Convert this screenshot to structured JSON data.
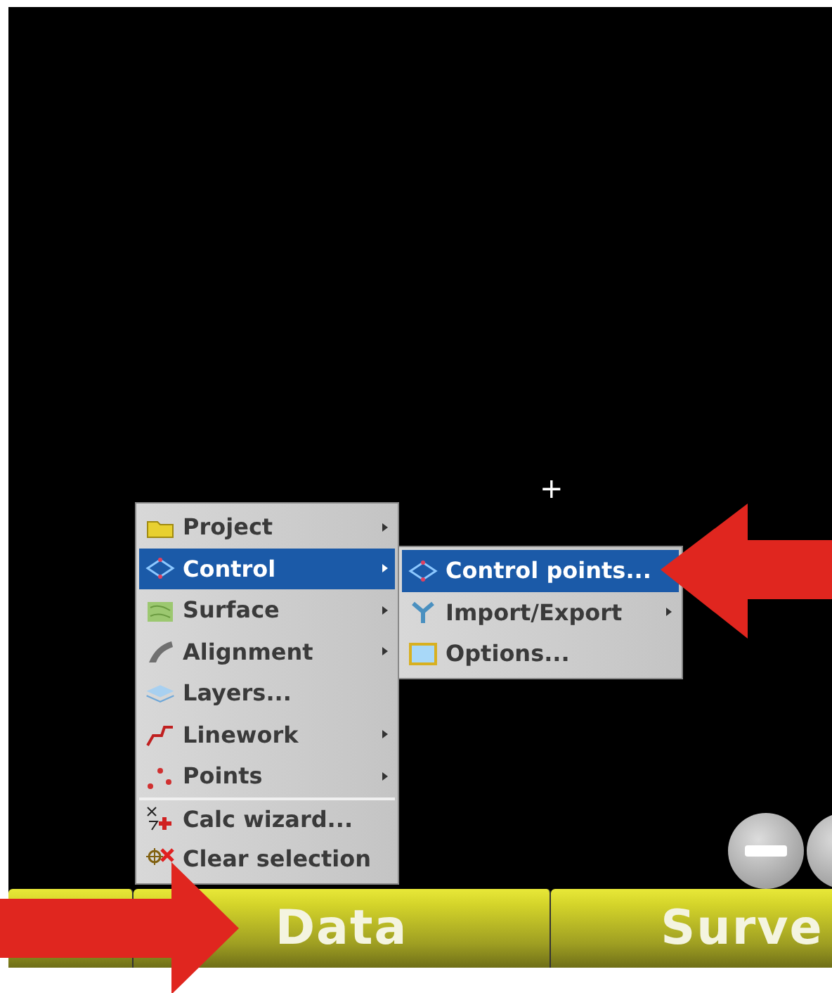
{
  "data_menu": {
    "items": [
      {
        "label": "Project",
        "kind": "folder",
        "selected": false,
        "has_submenu": true,
        "separator_before": false
      },
      {
        "label": "Control",
        "kind": "control",
        "selected": true,
        "has_submenu": true,
        "separator_before": false
      },
      {
        "label": "Surface",
        "kind": "surface",
        "selected": false,
        "has_submenu": true,
        "separator_before": false
      },
      {
        "label": "Alignment",
        "kind": "alignment",
        "selected": false,
        "has_submenu": true,
        "separator_before": false
      },
      {
        "label": "Layers...",
        "kind": "layers",
        "selected": false,
        "has_submenu": false,
        "separator_before": false
      },
      {
        "label": "Linework",
        "kind": "linework",
        "selected": false,
        "has_submenu": true,
        "separator_before": false
      },
      {
        "label": "Points",
        "kind": "points",
        "selected": false,
        "has_submenu": true,
        "separator_before": false
      },
      {
        "label": "Calc wizard...",
        "kind": "calc",
        "selected": false,
        "has_submenu": false,
        "separator_before": true
      },
      {
        "label": "Clear selection",
        "kind": "clear",
        "selected": false,
        "has_submenu": false,
        "separator_before": false
      }
    ]
  },
  "control_submenu": {
    "items": [
      {
        "label": "Control points...",
        "kind": "control",
        "selected": true,
        "has_submenu": false
      },
      {
        "label": "Import/Export",
        "kind": "importexport",
        "selected": false,
        "has_submenu": true
      },
      {
        "label": "Options...",
        "kind": "options",
        "selected": false,
        "has_submenu": false
      }
    ]
  },
  "crosshair": "+",
  "bottom_bar": {
    "tabs": [
      {
        "label": "Data"
      },
      {
        "label": "Surve"
      }
    ]
  }
}
